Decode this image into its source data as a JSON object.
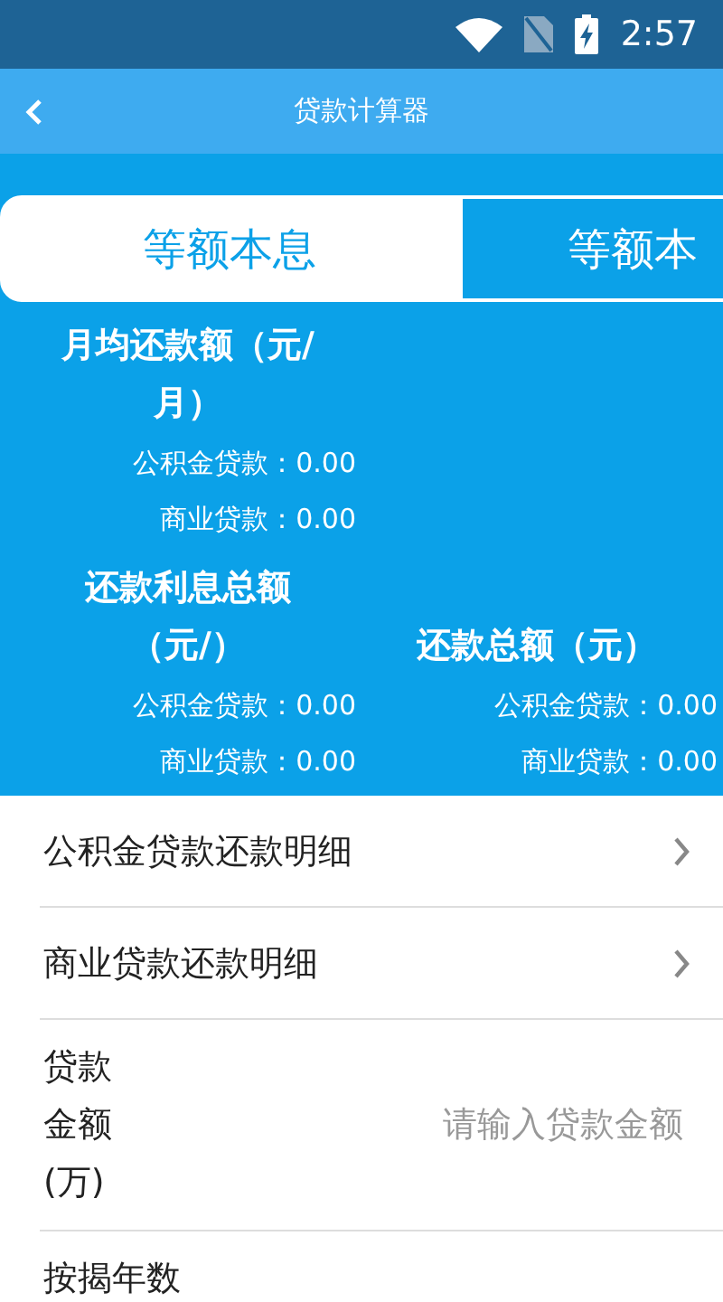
{
  "status_bar": {
    "time": "2:57"
  },
  "header": {
    "title": "贷款计算器"
  },
  "tabs": [
    {
      "label": "等额本息",
      "selected": true
    },
    {
      "label": "等额本",
      "selected": false
    }
  ],
  "results": {
    "left_column": [
      {
        "title": "月均还款额（元/月）",
        "rows": [
          {
            "label": "公积金贷款：0.00"
          },
          {
            "label": "商业贷款：0.00"
          }
        ]
      },
      {
        "title": "还款利息总额（元/）",
        "rows": [
          {
            "label": "公积金贷款：0.00"
          },
          {
            "label": "商业贷款：0.00"
          }
        ]
      }
    ],
    "right_column": [
      {
        "title": "还款总额（元）",
        "rows": [
          {
            "label": "公积金贷款：0.00"
          },
          {
            "label": "商业贷款：0.00"
          }
        ]
      }
    ]
  },
  "details": [
    {
      "label": "公积金贷款还款明细"
    },
    {
      "label": "商业贷款还款明细"
    }
  ],
  "fields": [
    {
      "label": "贷款金额(万)",
      "placeholder": "请输入贷款金额"
    },
    {
      "label": "按揭年数"
    }
  ]
}
